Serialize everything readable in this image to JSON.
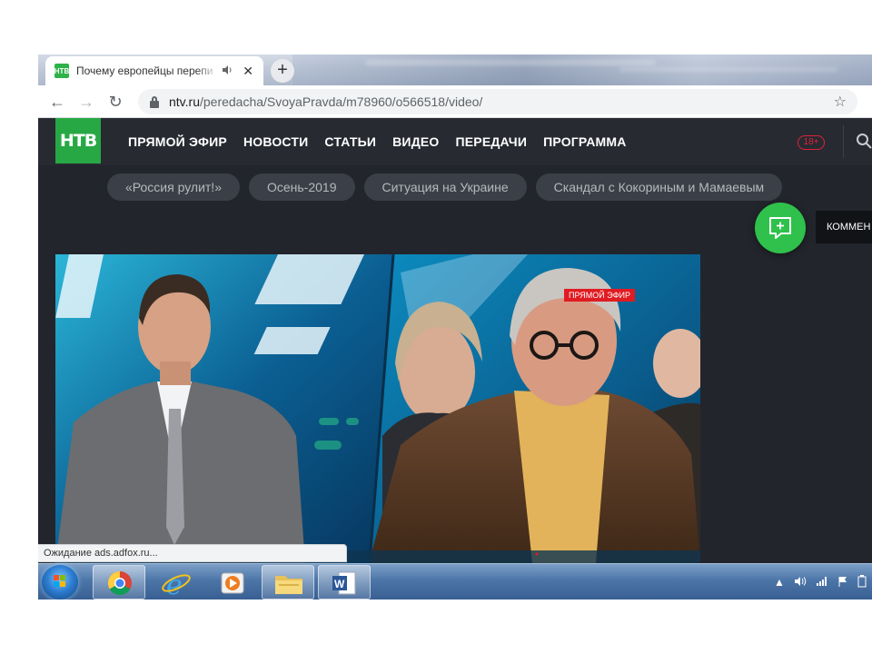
{
  "browser": {
    "tab": {
      "title": "Почему европейцы перепи",
      "favicon_text": "НТВ",
      "audio_icon": "speaker-icon",
      "close_glyph": "✕"
    },
    "new_tab_glyph": "+",
    "nav": {
      "back": "←",
      "forward": "→",
      "reload": "↻"
    },
    "address": {
      "domain": "ntv.ru",
      "path": "/peredacha/SvoyaPravda/m78960/o566518/video/",
      "star_glyph": "☆"
    },
    "status_text": "Ожидание ads.adfox.ru..."
  },
  "site": {
    "logo_text": "НТВ",
    "nav": [
      "ПРЯМОЙ ЭФИР",
      "НОВОСТИ",
      "СТАТЬИ",
      "ВИДЕО",
      "ПЕРЕДАЧИ",
      "ПРОГРАММА"
    ],
    "age_rating": "18+",
    "tags": [
      "«Россия рулит!»",
      "Осень-2019",
      "Ситуация на Украине",
      "Скандал с Кокориным и Мамаевым"
    ],
    "comment_label": "КОММЕН",
    "video": {
      "live_badge": "ПРЯМОЙ ЭФИР"
    },
    "colors": {
      "brand_green": "#27a844",
      "header_bg": "#272a31",
      "live_red": "#e01b22"
    }
  },
  "taskbar": {
    "apps": [
      "chrome-icon",
      "internet-explorer-icon",
      "media-player-icon",
      "file-explorer-icon",
      "word-icon"
    ],
    "tray": [
      "show-hidden-icons",
      "volume-icon",
      "network-icon",
      "action-center-flag-icon",
      "power-icon"
    ]
  }
}
